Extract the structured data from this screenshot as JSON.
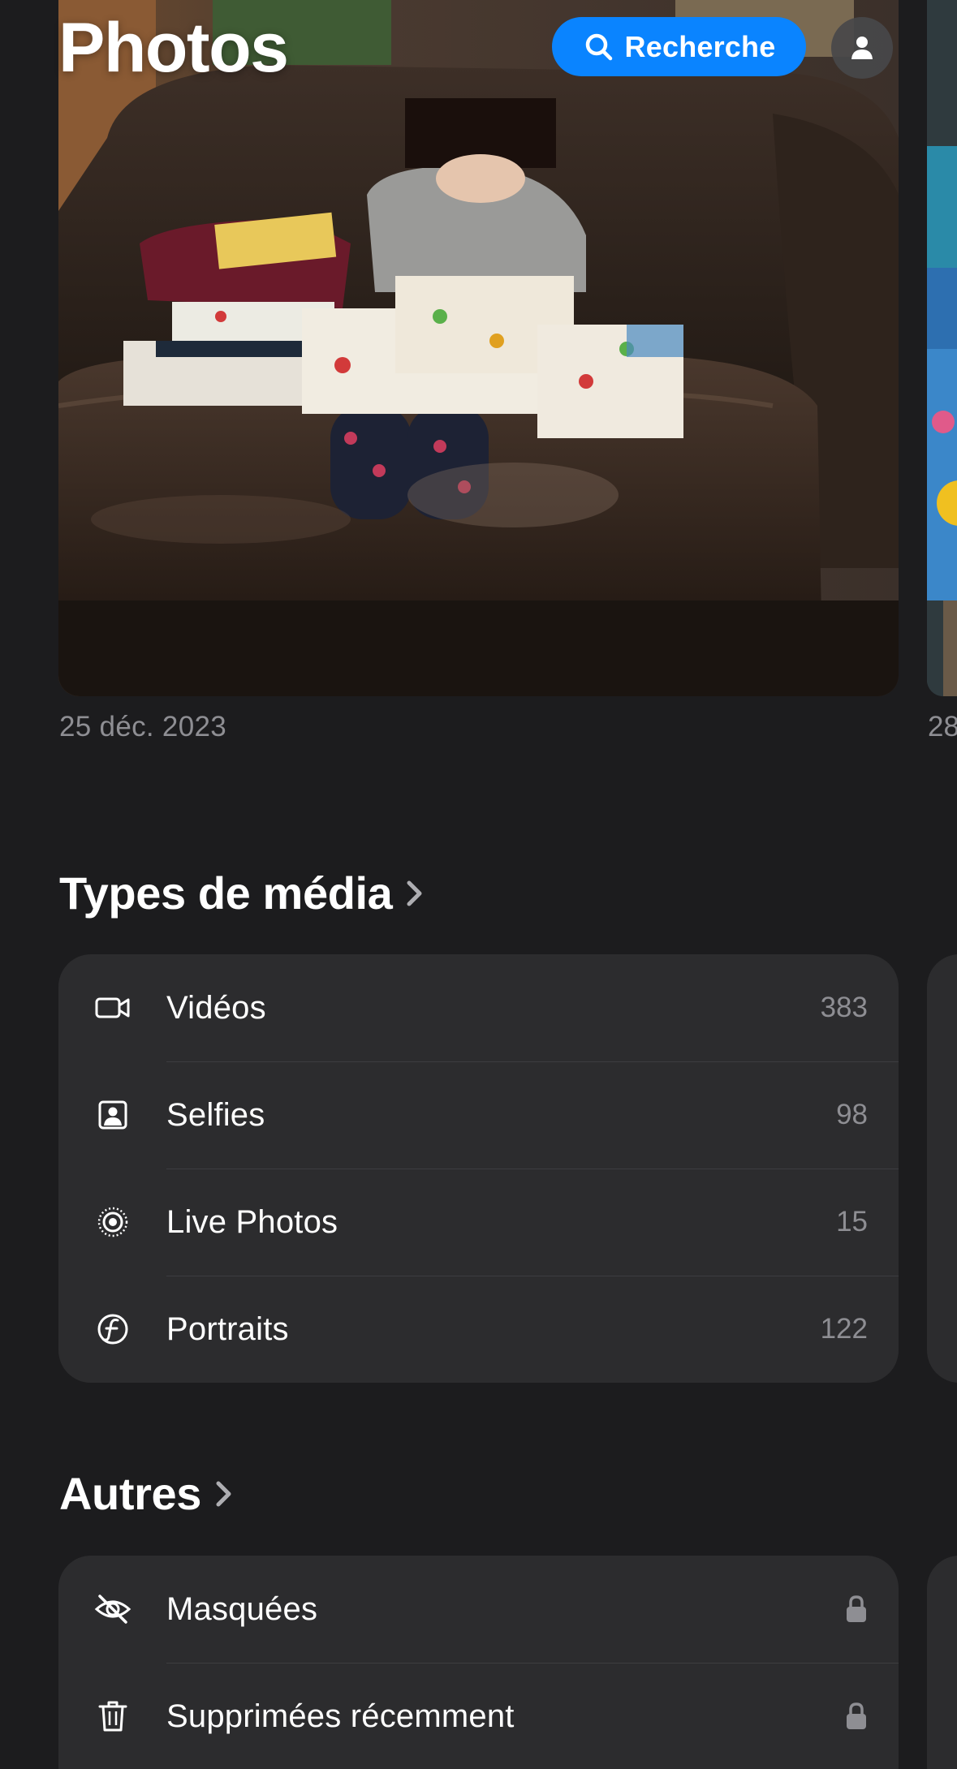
{
  "header": {
    "title": "Photos",
    "search_label": "Recherche",
    "search_icon": "magnifying-glass",
    "profile_icon": "person-silhouette"
  },
  "featured": {
    "date": "25 déc. 2023",
    "next_date_partial": "28"
  },
  "media_types": {
    "title": "Types de média",
    "items": [
      {
        "label": "Vidéos",
        "count": "383",
        "icon": "video-camera"
      },
      {
        "label": "Selfies",
        "count": "98",
        "icon": "person-square"
      },
      {
        "label": "Live Photos",
        "count": "15",
        "icon": "live-photo-rings"
      },
      {
        "label": "Portraits",
        "count": "122",
        "icon": "aperture-f"
      }
    ]
  },
  "others": {
    "title": "Autres",
    "items": [
      {
        "label": "Masquées",
        "icon": "eye-slash",
        "status_icon": "lock"
      },
      {
        "label": "Supprimées récemment",
        "icon": "trash",
        "status_icon": "lock"
      }
    ]
  },
  "colors": {
    "background": "#1c1c1e",
    "card": "#2c2c2e",
    "accent": "#0a84ff",
    "secondary_text": "#8e8e93"
  }
}
